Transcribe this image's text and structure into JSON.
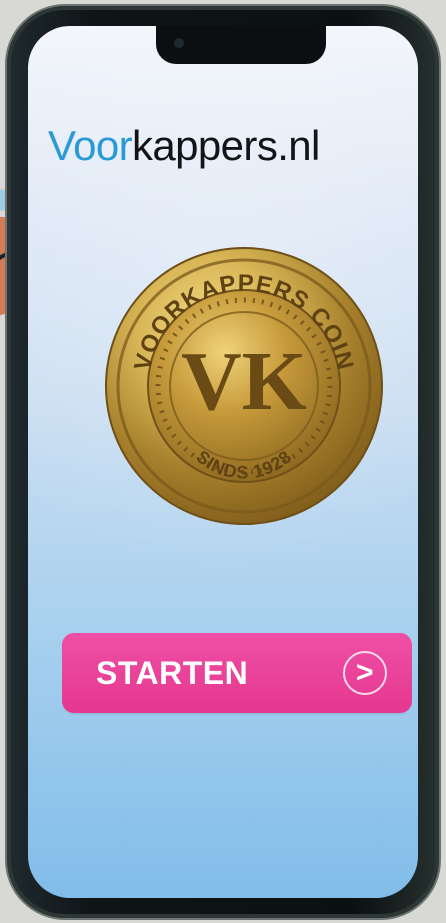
{
  "app": {
    "brand_blue": "Voor",
    "brand_dark": "kappers.nl"
  },
  "coin": {
    "top_text": "VOORKAPPERS COIN",
    "center_text": "VK",
    "bottom_text": "SINDS 1928"
  },
  "actions": {
    "start_label": "STARTEN",
    "arrow_icon": "chevron-right-icon",
    "arrow_symbol": ">"
  },
  "colors": {
    "accent": "#e5378f",
    "brand_blue": "#2a9ad7",
    "text_dark": "#121417",
    "coin_gold": "#c9a345"
  }
}
